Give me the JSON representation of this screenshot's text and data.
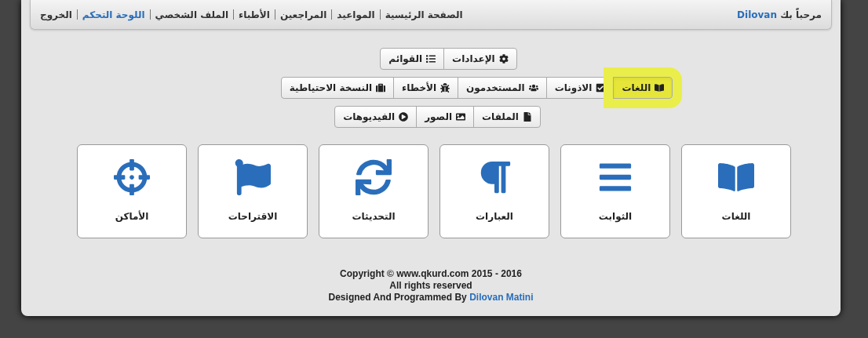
{
  "nav": {
    "welcome": "مرحباً بك",
    "user": "Dilovan",
    "links": [
      {
        "label": "الصفحة الرئيسية",
        "selected": false
      },
      {
        "label": "المواعيد",
        "selected": false
      },
      {
        "label": "المراجعين",
        "selected": false
      },
      {
        "label": "الأطباء",
        "selected": false
      },
      {
        "label": "الملف الشخصي",
        "selected": false
      },
      {
        "label": "اللوحة التحكم",
        "selected": true
      },
      {
        "label": "الخروج",
        "selected": false
      }
    ]
  },
  "button_groups": [
    [
      {
        "label": "الإعدادات",
        "selected": false
      },
      {
        "label": "القوائم",
        "selected": false
      }
    ],
    [
      {
        "label": "اللغات",
        "selected": true
      },
      {
        "label": "الاذونات",
        "selected": false
      },
      {
        "label": "المستخدمون",
        "selected": false
      },
      {
        "label": "الأخطاء",
        "selected": false
      },
      {
        "label": "النسخة الاحتياطية",
        "selected": false
      }
    ],
    [
      {
        "label": "الملفات",
        "selected": false
      },
      {
        "label": "الصور",
        "selected": false
      },
      {
        "label": "الفيديوهات",
        "selected": false
      }
    ]
  ],
  "cards": [
    {
      "label": "اللغات"
    },
    {
      "label": "الثوابت"
    },
    {
      "label": "العبارات"
    },
    {
      "label": "التحديثات"
    },
    {
      "label": "الاقتراحات"
    },
    {
      "label": "الأماكن"
    }
  ],
  "footer": {
    "copyright": "Copyright © www.qkurd.com 2015 - 2016",
    "rights": "All rights reserved",
    "designed_by": "Designed And Programmed By",
    "author": "Dilovan Matini"
  }
}
